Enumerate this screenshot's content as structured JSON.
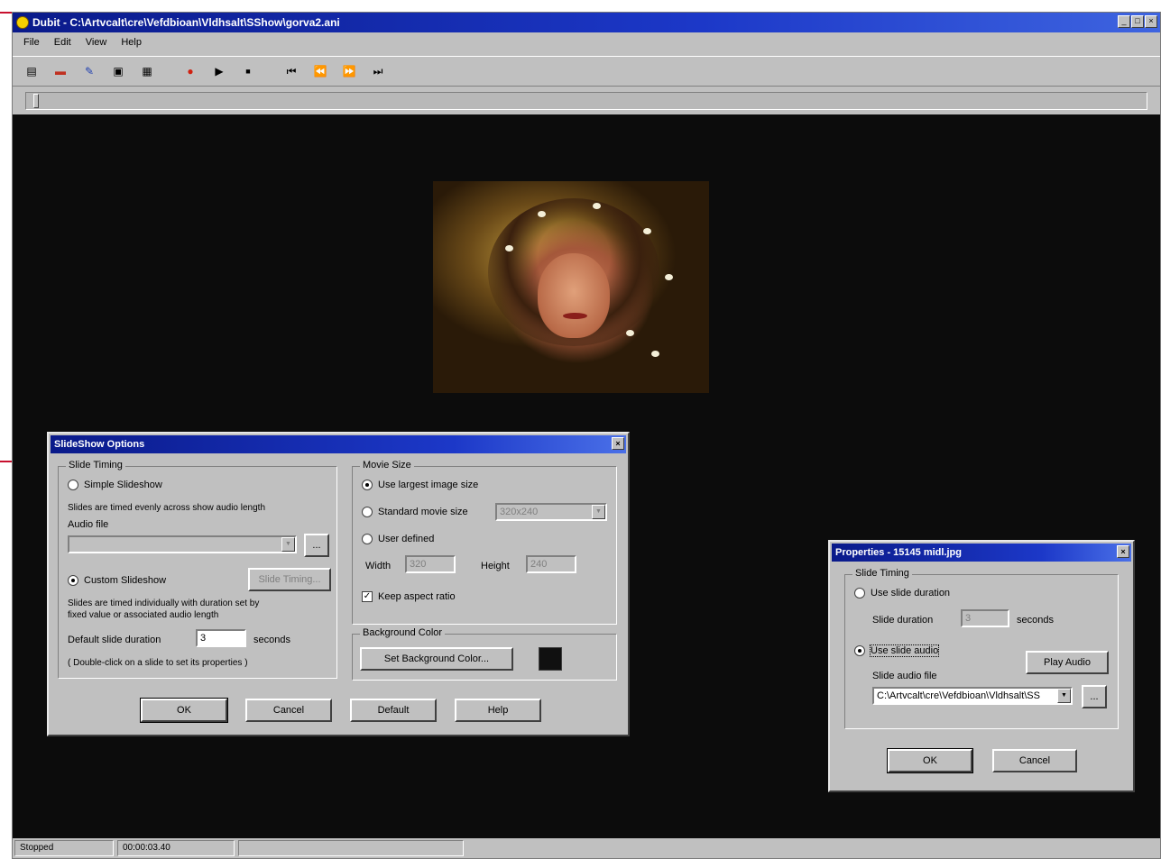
{
  "window": {
    "title": "Dubit - C:\\Artvcalt\\cre\\Vefdbioan\\Vldhsalt\\SShow\\gorva2.ani"
  },
  "menu": [
    "File",
    "Edit",
    "View",
    "Help"
  ],
  "toolbar": {
    "buttons": [
      "open-icon",
      "save-icon",
      "effects-icon",
      "export-icon",
      "slideshow-icon",
      "record-icon",
      "play-icon",
      "stop-icon",
      "first-frame-icon",
      "previous-frame-icon",
      "next-frame-icon",
      "last-frame-icon"
    ],
    "glyphs": [
      "▤",
      "▬",
      "✎",
      "▣",
      "▦",
      "●",
      "▶",
      "■",
      "⏮",
      "⏪",
      "⏩",
      "⏭"
    ]
  },
  "slideshow_dialog": {
    "title": "SlideShow Options",
    "slide_timing_label": "Slide Timing",
    "simple_slideshow": "Simple Slideshow",
    "simple_desc": "Slides are timed evenly across show audio length",
    "audio_file_label": "Audio file",
    "audio_file_value": "",
    "browse": "...",
    "custom_slideshow": "Custom Slideshow",
    "timing_button": "Slide Timing...",
    "custom_desc_1": "Slides are timed individually with duration set by",
    "custom_desc_2": "fixed value or associated audio length",
    "default_duration_label": "Default slide duration",
    "default_duration_value": "3",
    "seconds": "seconds",
    "double_click_hint": "( Double-click on a slide to set its properties )",
    "movie_size_label": "Movie Size",
    "use_largest": "Use largest image size",
    "standard_size": "Standard movie size",
    "standard_size_value": "320x240",
    "user_defined": "User defined",
    "width_label": "Width",
    "width_value": "320",
    "height_label": "Height",
    "height_value": "240",
    "keep_aspect": "Keep aspect ratio",
    "bg_color_label": "Background Color",
    "set_bg_button": "Set Background Color...",
    "ok": "OK",
    "cancel": "Cancel",
    "default": "Default",
    "help": "Help",
    "background_color": "#101010"
  },
  "properties_dialog": {
    "title": "Properties - 15145 midl.jpg",
    "slide_timing_label": "Slide Timing",
    "use_slide_duration": "Use slide duration",
    "slide_duration_label": "Slide duration",
    "slide_duration_value": "3",
    "seconds": "seconds",
    "use_slide_audio": "Use slide audio",
    "play_audio": "Play Audio",
    "slide_audio_label": "Slide audio file",
    "slide_audio_value": "C:\\Artvcalt\\cre\\Vefdbioan\\Vldhsalt\\SS",
    "browse": "...",
    "ok": "OK",
    "cancel": "Cancel"
  },
  "status": {
    "state": "Stopped",
    "time": "00:00:03.40"
  },
  "colors": {
    "title_bar": "#1c38c8",
    "canvas_bg": "#0c0c0c",
    "face": "#c97c5a"
  }
}
